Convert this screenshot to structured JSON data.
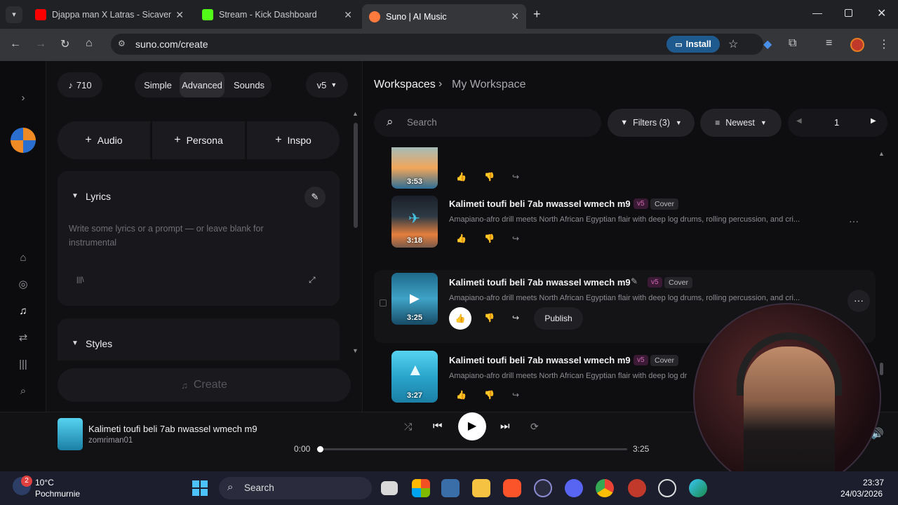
{
  "browser": {
    "tabs": [
      {
        "label": "Djappa man X Latras - Sicavene",
        "favicon_color": "#ff0000"
      },
      {
        "label": "Stream - Kick Dashboard",
        "favicon_color": "#53fc18"
      },
      {
        "label": "Suno | AI Music",
        "favicon_color": "#ff7a3d"
      }
    ],
    "url": "suno.com/create",
    "install_label": "Install"
  },
  "left": {
    "credits": "710",
    "modes": [
      "Simple",
      "Advanced",
      "Sounds"
    ],
    "active_mode": "Advanced",
    "version": "v5",
    "add_buttons": [
      "Audio",
      "Persona",
      "Inspo"
    ],
    "lyrics_label": "Lyrics",
    "lyrics_placeholder": "Write some lyrics or a prompt — or leave blank for instrumental",
    "styles_label": "Styles",
    "create_label": "Create"
  },
  "right": {
    "breadcrumb_root": "Workspaces",
    "breadcrumb_current": "My Workspace",
    "search_placeholder": "Search",
    "filters_label": "Filters (3)",
    "sort_label": "Newest",
    "page": "1",
    "songs": [
      {
        "duration": "3:53",
        "title": "",
        "badge": "",
        "tag": "",
        "desc": ""
      },
      {
        "duration": "3:18",
        "title": "Kalimeti toufi beli 7ab nwassel wmech m9",
        "badge": "v5",
        "tag": "Cover",
        "desc": "Amapiano-afro drill meets North African Egyptian flair with deep log drums, rolling percussion, and cri..."
      },
      {
        "duration": "3:25",
        "title": "Kalimeti toufi beli 7ab nwassel wmech m9",
        "badge": "v5",
        "tag": "Cover",
        "desc": "Amapiano-afro drill meets North African Egyptian flair with deep log drums, rolling percussion, and cri...",
        "publish": "Publish"
      },
      {
        "duration": "3:27",
        "title": "Kalimeti toufi beli 7ab nwassel wmech m9",
        "badge": "v5",
        "tag": "Cover",
        "desc": "Amapiano-afro drill meets North African Egyptian flair with deep log dr"
      }
    ]
  },
  "player": {
    "title": "Kalimeti toufi beli 7ab nwassel wmech m9",
    "artist": "zomriman01",
    "elapsed": "0:00",
    "total": "3:25",
    "progress": 0.01
  },
  "taskbar": {
    "weather_temp": "10°C",
    "weather_desc": "Pochmurnie",
    "search_label": "Search",
    "notification_count": "2",
    "time": "23:37",
    "date": "24/03/2026"
  }
}
